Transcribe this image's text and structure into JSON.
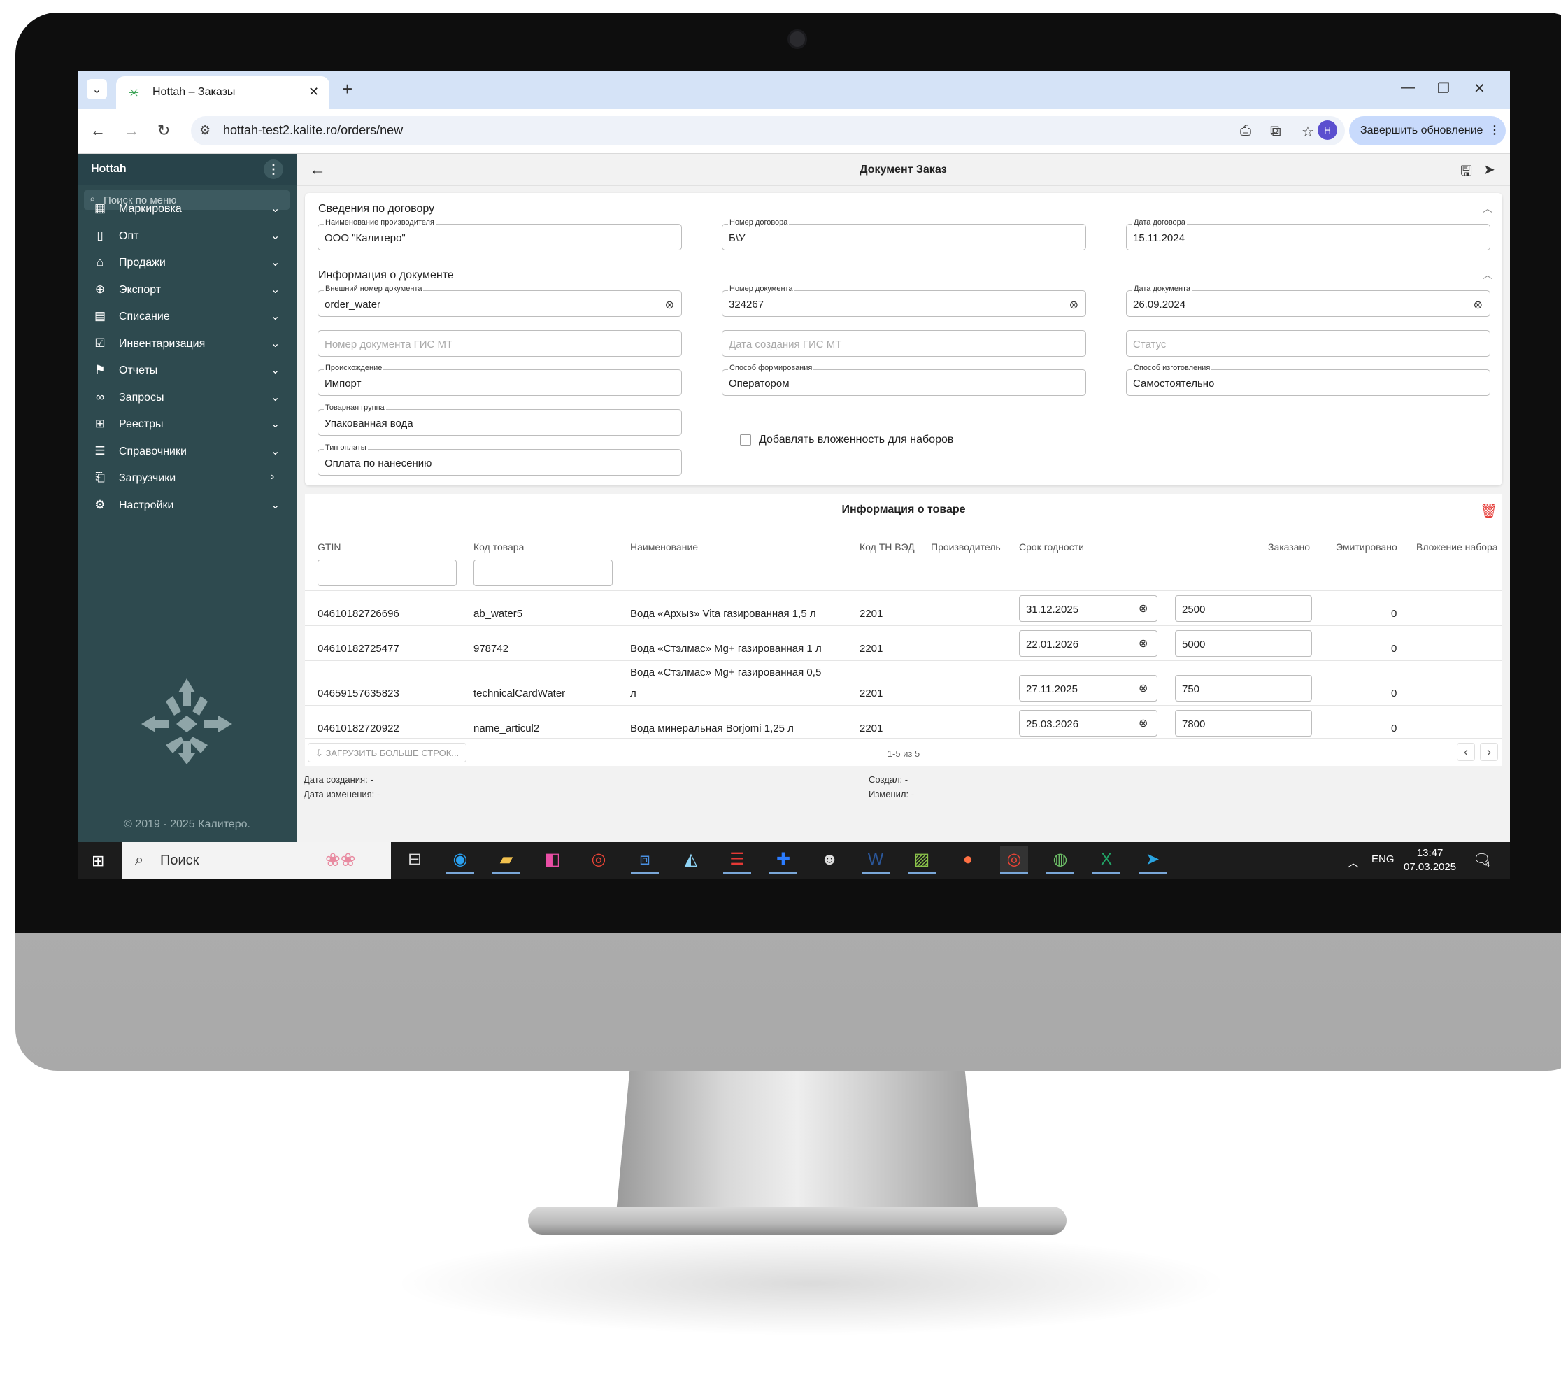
{
  "browser": {
    "tab_title": "Hottah – Заказы",
    "url": "hottah-test2.kalite.ro/orders/new",
    "profile_initial": "H",
    "update_label": "Завершить обновление"
  },
  "sidebar": {
    "title": "Hottah",
    "search_placeholder": "Поиск по меню",
    "items": [
      {
        "label": "Маркировка",
        "icon": "grid-icon"
      },
      {
        "label": "Опт",
        "icon": "document-icon"
      },
      {
        "label": "Продажи",
        "icon": "basket-icon"
      },
      {
        "label": "Экспорт",
        "icon": "globe-icon"
      },
      {
        "label": "Списание",
        "icon": "clipboard-icon"
      },
      {
        "label": "Инвентаризация",
        "icon": "clipboard-check-icon"
      },
      {
        "label": "Отчеты",
        "icon": "flag-icon"
      },
      {
        "label": "Запросы",
        "icon": "link-icon"
      },
      {
        "label": "Реестры",
        "icon": "table-icon"
      },
      {
        "label": "Справочники",
        "icon": "list-icon"
      },
      {
        "label": "Загрузчики",
        "icon": "upload-file-icon"
      },
      {
        "label": "Настройки",
        "icon": "gears-icon"
      }
    ],
    "copyright": "© 2019 - 2025 Калитеро."
  },
  "page": {
    "title": "Документ Заказ"
  },
  "contract": {
    "section_title": "Сведения по договору",
    "manufacturer_label": "Наименование производителя",
    "manufacturer_value": "ООО \"Калитеро\"",
    "contract_no_label": "Номер договора",
    "contract_no_value": "Б\\У",
    "contract_date_label": "Дата договора",
    "contract_date_value": "15.11.2024"
  },
  "document": {
    "section_title": "Информация о документе",
    "ext_no_label": "Внешний номер документа",
    "ext_no_value": "order_water",
    "doc_no_label": "Номер документа",
    "doc_no_value": "324267",
    "doc_date_label": "Дата документа",
    "doc_date_value": "26.09.2024",
    "gis_no_placeholder": "Номер документа ГИС МТ",
    "gis_date_placeholder": "Дата создания ГИС МТ",
    "status_placeholder": "Статус",
    "origin_label": "Происхождение",
    "origin_value": "Импорт",
    "formation_label": "Способ формирования",
    "formation_value": "Оператором",
    "production_label": "Способ изготовления",
    "production_value": "Самостоятельно",
    "group_label": "Товарная группа",
    "group_value": "Упакованная вода",
    "payment_label": "Тип оплаты",
    "payment_value": "Оплата по нанесению",
    "nesting_label": "Добавлять вложенность для наборов"
  },
  "goods": {
    "title": "Информация о товаре",
    "columns": [
      "GTIN",
      "Код товара",
      "Наименование",
      "Код ТН ВЭД",
      "Производитель",
      "Срок годности",
      "Заказано",
      "Эмитировано",
      "Вложение набора"
    ],
    "rows": [
      {
        "gtin": "04610182726696",
        "code": "ab_water5",
        "name": "Вода «Архыз» Vita газированная 1,5 л",
        "tnved": "2201",
        "expiry": "31.12.2025",
        "ordered": "2500",
        "emitted": "0"
      },
      {
        "gtin": "04610182725477",
        "code": "978742",
        "name": "Вода «Стэлмас» Mg+ газированная 1 л",
        "tnved": "2201",
        "expiry": "22.01.2026",
        "ordered": "5000",
        "emitted": "0"
      },
      {
        "gtin": "04659157635823",
        "code": "technicalCardWater",
        "name_line1": "Вода «Стэлмас» Mg+ газированная 0,5",
        "name_line2": "л",
        "tnved": "2201",
        "expiry": "27.11.2025",
        "ordered": "750",
        "emitted": "0"
      },
      {
        "gtin": "04610182720922",
        "code": "name_articul2",
        "name": "Вода минеральная Borjomi 1,25 л",
        "tnved": "2201",
        "expiry": "25.03.2026",
        "ordered": "7800",
        "emitted": "0"
      }
    ],
    "load_more": "ЗАГРУЗИТЬ БОЛЬШЕ СТРОК...",
    "pager": "1-5 из 5"
  },
  "meta": {
    "created_date": "Дата создания: -",
    "modified_date": "Дата изменения: -",
    "created_by": "Создал: -",
    "modified_by": "Изменил: -"
  },
  "taskbar": {
    "search": "Поиск",
    "lang": "ENG",
    "time": "13:47",
    "date": "07.03.2025",
    "notifications": "4"
  },
  "colors": {
    "sidebar": "#2e4a4f",
    "accent_delete": "#e53935",
    "update_button": "#c8dafc"
  }
}
